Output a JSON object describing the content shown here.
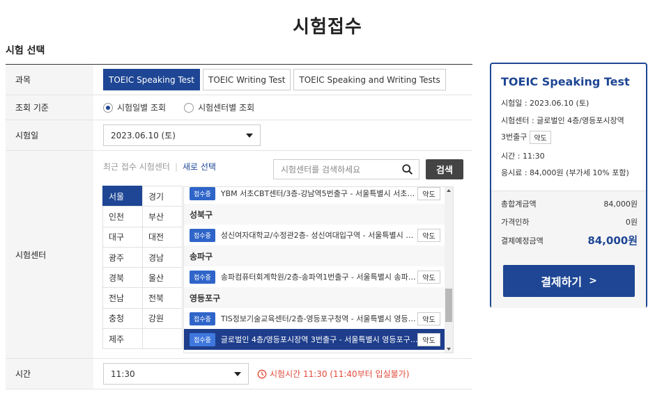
{
  "page": {
    "title": "시험접수",
    "section_title": "시험 선택"
  },
  "subject": {
    "label": "과목",
    "options": [
      "TOEIC Speaking Test",
      "TOEIC Writing Test",
      "TOEIC Speaking and Writing Tests"
    ],
    "selected_index": 0
  },
  "basis": {
    "label": "조회 기준",
    "options": [
      "시험일별 조회",
      "시험센터별 조회"
    ],
    "selected_index": 0
  },
  "date": {
    "label": "시험일",
    "value": "2023.06.10 (토)"
  },
  "center": {
    "label": "시험센터",
    "recent_label": "최근 접수 시험센터",
    "new_select": "새로 선택",
    "search_placeholder": "시험센터를 검색하세요",
    "search_button": "검색",
    "regions": [
      "서울",
      "경기",
      "인천",
      "부산",
      "대구",
      "대전",
      "광주",
      "경남",
      "경북",
      "울산",
      "전남",
      "전북",
      "충청",
      "강원",
      "제주",
      ""
    ],
    "selected_region": "서울",
    "badge": "접수중",
    "map_label": "약도",
    "list": [
      {
        "type": "item",
        "name": "YBM 서초CBT센터/3층-강남역5번출구 - 서울특별시 서초구 …"
      },
      {
        "type": "district",
        "name": "성북구"
      },
      {
        "type": "item",
        "name": "성신여자대학교/수정관2층- 성신여대입구역 - 서울특별시 성…"
      },
      {
        "type": "district",
        "name": "송파구"
      },
      {
        "type": "item",
        "name": "송파컴퓨터회계학원/2층-송파역1번출구 - 서울특별시 송파구 …"
      },
      {
        "type": "district",
        "name": "영등포구"
      },
      {
        "type": "item",
        "name": "TIS정보기술교육센터/2층-영등포구청역 - 서울특별시 영등포…"
      },
      {
        "type": "item",
        "name": "글로벌인 4층/영등포시장역 3번출구 - 서울특별시 영등포구 …",
        "selected": true
      }
    ]
  },
  "time": {
    "label": "시간",
    "value": "11:30",
    "warning": "시험시간 11:30 (11:40부터 입실불가)"
  },
  "summary": {
    "title": "TOEIC Speaking Test",
    "date_line": "시험일 : 2023.06.10 (토)",
    "center_line1": "시험센터 : 글로벌인 4층/영등포시장역",
    "center_line2": "3번출구",
    "map_label": "약도",
    "time_line": "시간 : 11:30",
    "fee_line": "응시료 : 84,000원 (부가세 10% 포함)",
    "total_label": "총합계금액",
    "total_value": "84,000원",
    "discount_label": "가격인하",
    "discount_value": "0원",
    "final_label": "결제예정금액",
    "final_value": "84,000원",
    "pay_button": "결제하기"
  },
  "colors": {
    "brand": "#1e4694",
    "warning": "#e14b3b",
    "badge": "#2f65c9"
  }
}
